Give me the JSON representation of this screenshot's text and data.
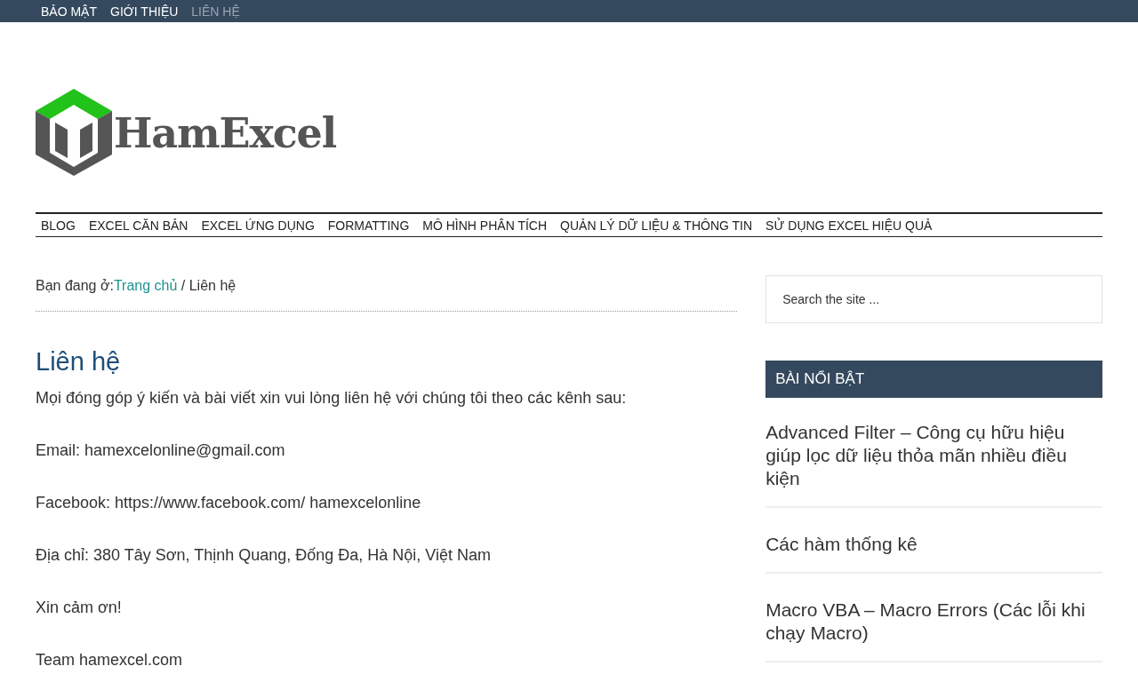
{
  "top_nav": [
    {
      "label": "BẢO MẬT",
      "selected": false
    },
    {
      "label": "GIỚI THIỆU",
      "selected": false
    },
    {
      "label": "LIÊN HỆ",
      "selected": true
    }
  ],
  "logo": {
    "text": "HamExcel"
  },
  "main_nav": [
    "BLOG",
    "EXCEL CĂN BẢN",
    "EXCEL ỨNG DỤNG",
    "FORMATTING",
    "MÔ HÌNH PHÂN TÍCH",
    "QUẢN LÝ DỮ LIỆU & THÔNG TIN",
    "SỬ DỤNG EXCEL HIỆU QUẢ"
  ],
  "breadcrumb": {
    "prefix": "Bạn đang ở:",
    "link": "Trang chủ",
    "separator": " / ",
    "current": "Liên hệ"
  },
  "page_title": "Liên hệ",
  "paragraphs": [
    "Mọi đóng góp ý kiến và bài viết xin vui lòng liên hệ với chúng tôi theo các kênh sau:",
    "Email: hamexcelonline@gmail.com",
    "Facebook: https://www.facebook.com/ hamexcelonline",
    "Địa chỉ: 380 Tây Sơn, Thịnh Quang, Đống Đa, Hà Nội, Việt Nam",
    "Xin cảm ơn!",
    "Team hamexcel.com"
  ],
  "search": {
    "placeholder": "Search the site ..."
  },
  "featured": {
    "title": "BÀI NỔI BẬT",
    "posts": [
      "Advanced Filter – Công cụ hữu hiệu giúp lọc dữ liệu thỏa mãn nhiều điều kiện",
      "Các hàm thống kê",
      "Macro VBA – Macro Errors (Các lỗi khi chạy Macro)"
    ]
  }
}
